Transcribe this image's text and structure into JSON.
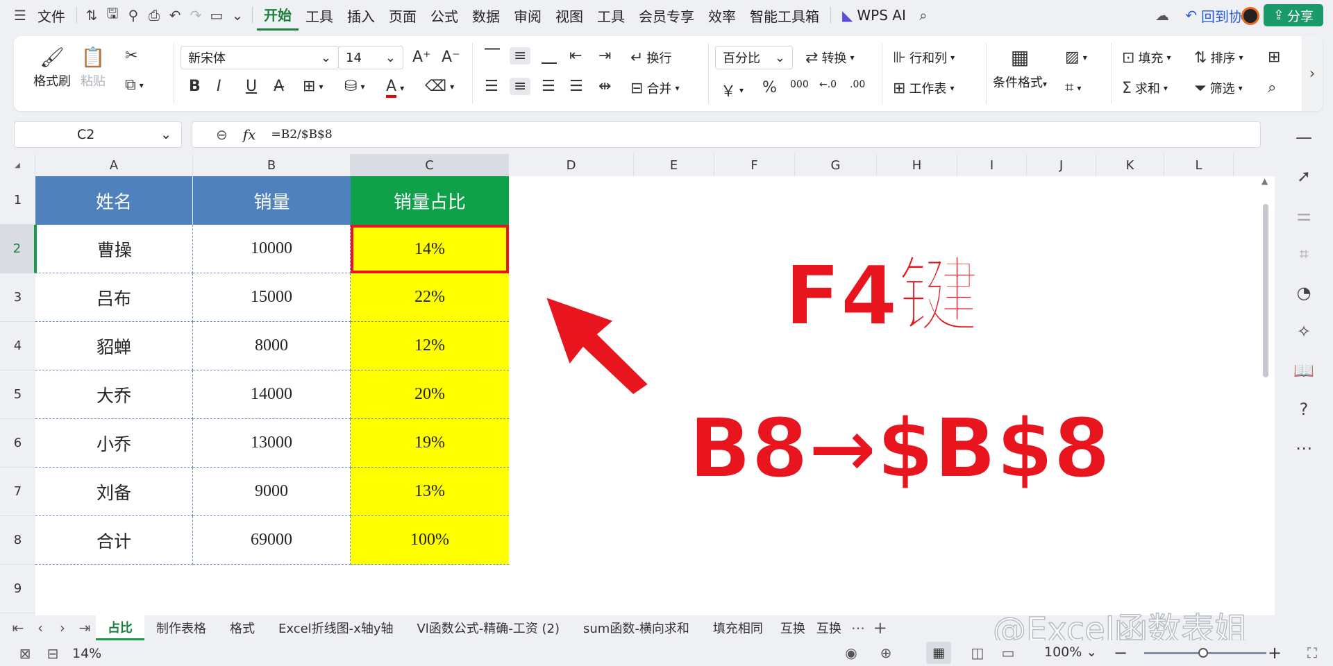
{
  "menubar": {
    "file": "文件",
    "tabs": [
      "开始",
      "工具",
      "插入",
      "页面",
      "公式",
      "数据",
      "审阅",
      "视图",
      "工具",
      "会员专享",
      "效率",
      "智能工具箱"
    ],
    "active_tab": "开始",
    "wps_ai": "WPS AI",
    "collab": "回到协作",
    "share": "分享"
  },
  "ribbon": {
    "format_painter": "格式刷",
    "paste": "粘贴",
    "font_name": "新宋体",
    "font_size": "14",
    "wrap": "换行",
    "merge": "合并",
    "number_format": "百分比",
    "convert": "转换",
    "rows_cols": "行和列",
    "worksheet": "工作表",
    "cond_format": "条件格式",
    "fill": "填充",
    "sort": "排序",
    "sum": "求和",
    "filter": "筛选",
    "currency_symbol": "￥",
    "percent_symbol": "%",
    "thousands_symbol": "000"
  },
  "formula_bar": {
    "cell_ref": "C2",
    "fx": "fx",
    "formula": "=B2/$B$8"
  },
  "columns": [
    "A",
    "B",
    "C",
    "D",
    "E",
    "F",
    "G",
    "H",
    "I",
    "J",
    "K",
    "L"
  ],
  "rows": [
    "1",
    "2",
    "3",
    "4",
    "5",
    "6",
    "7",
    "8",
    "9"
  ],
  "table": {
    "headers": [
      "姓名",
      "销量",
      "销量占比"
    ],
    "rows": [
      [
        "曹操",
        "10000",
        "14%"
      ],
      [
        "吕布",
        "15000",
        "22%"
      ],
      [
        "貂蝉",
        "8000",
        "12%"
      ],
      [
        "大乔",
        "14000",
        "20%"
      ],
      [
        "小乔",
        "13000",
        "19%"
      ],
      [
        "刘备",
        "9000",
        "13%"
      ],
      [
        "合计",
        "69000",
        "100%"
      ]
    ]
  },
  "annotations": {
    "title": "F4键",
    "subtitle": "B8→$B$8"
  },
  "sheet_tabs": [
    "占比",
    "制作表格",
    "格式",
    "Excel折线图-x轴y轴",
    "Vl函数公式-精确-工资 (2)",
    "sum函数-横向求和",
    "填充相同",
    "互换",
    "互换"
  ],
  "active_sheet": "占比",
  "watermark": "@Excel函数表姐",
  "status": {
    "zoom_left": "14%",
    "zoom": "100%"
  },
  "colors": {
    "header_blue": "#4f81bd",
    "header_green": "#0fa14a",
    "highlight_yellow": "#ffff00",
    "annotation_red": "#e8151f",
    "accent_green": "#1a7f3c"
  }
}
